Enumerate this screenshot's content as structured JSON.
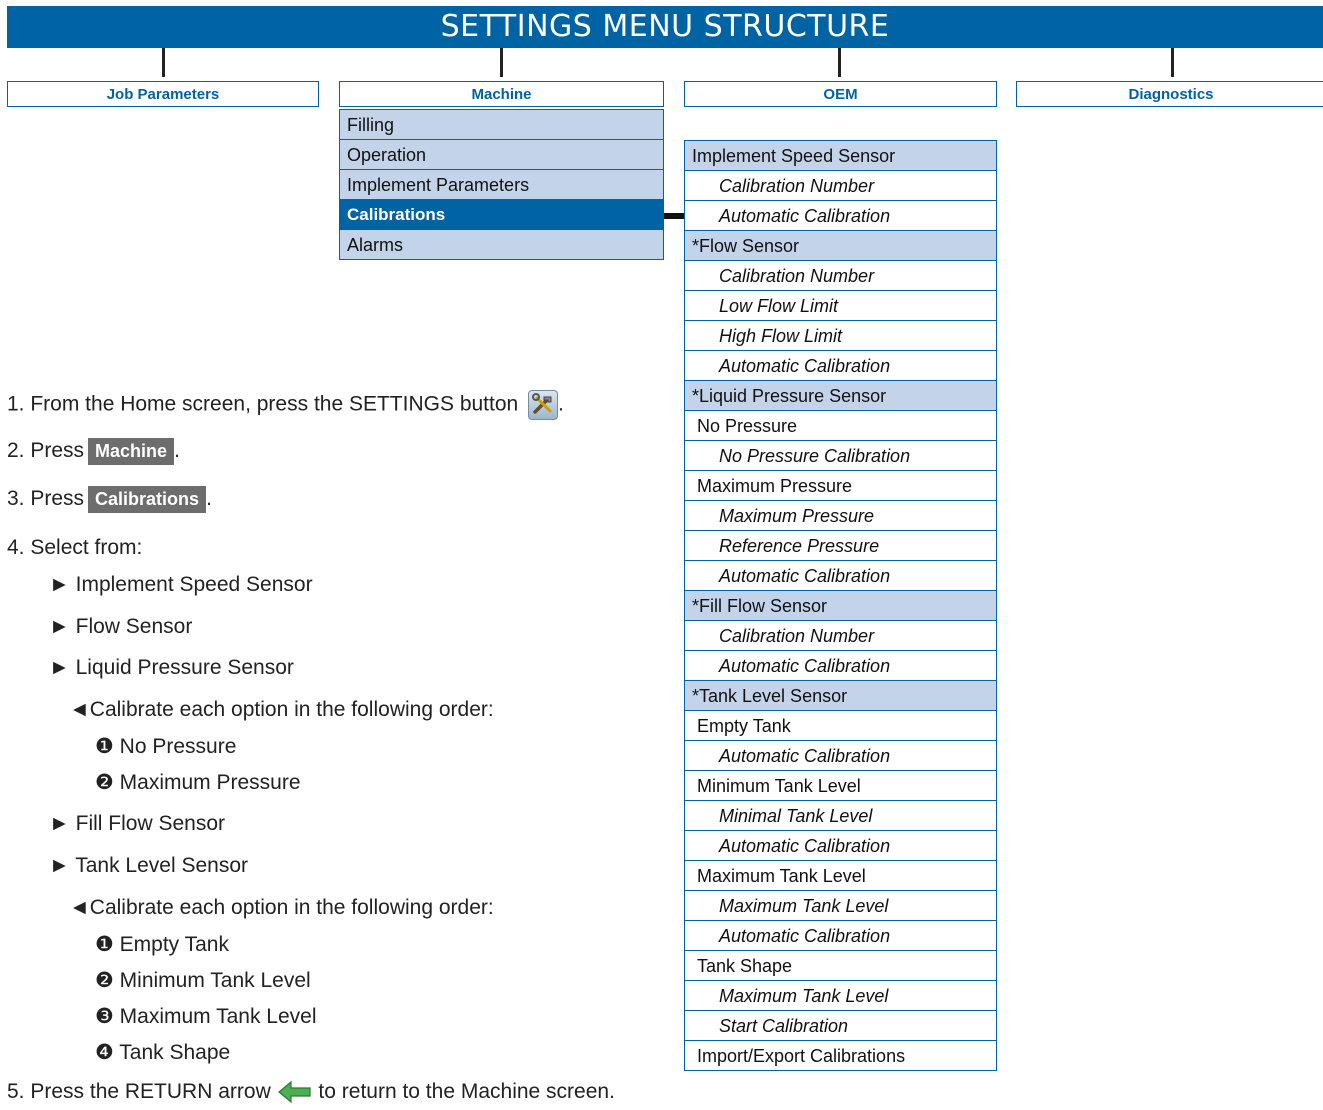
{
  "banner": {
    "title": "SETTINGS MENU STRUCTURE"
  },
  "tabs": [
    {
      "label": "Job Parameters"
    },
    {
      "label": "Machine"
    },
    {
      "label": "OEM"
    },
    {
      "label": "Diagnostics"
    }
  ],
  "machine_menu": [
    {
      "label": "Filling"
    },
    {
      "label": "Operation"
    },
    {
      "label": "Implement Parameters"
    },
    {
      "label": "Calibrations",
      "active": true
    },
    {
      "label": "Alarms"
    }
  ],
  "calibrations_menu": [
    {
      "label": "Implement Speed Sensor",
      "kind": "hdr"
    },
    {
      "label": "Calibration Number",
      "kind": "item"
    },
    {
      "label": "Automatic Calibration",
      "kind": "item"
    },
    {
      "label": "*Flow Sensor",
      "kind": "hdr"
    },
    {
      "label": "Calibration Number",
      "kind": "item"
    },
    {
      "label": "Low Flow Limit",
      "kind": "item"
    },
    {
      "label": "High Flow Limit",
      "kind": "item"
    },
    {
      "label": "Automatic Calibration",
      "kind": "item"
    },
    {
      "label": "*Liquid Pressure Sensor",
      "kind": "hdr"
    },
    {
      "label": "No Pressure",
      "kind": "sub"
    },
    {
      "label": "No Pressure Calibration",
      "kind": "item"
    },
    {
      "label": "Maximum Pressure",
      "kind": "sub"
    },
    {
      "label": "Maximum Pressure",
      "kind": "item"
    },
    {
      "label": "Reference Pressure",
      "kind": "item"
    },
    {
      "label": "Automatic Calibration",
      "kind": "item"
    },
    {
      "label": "*Fill Flow Sensor",
      "kind": "hdr"
    },
    {
      "label": "Calibration Number",
      "kind": "item"
    },
    {
      "label": "Automatic Calibration",
      "kind": "item"
    },
    {
      "label": "*Tank Level Sensor",
      "kind": "hdr"
    },
    {
      "label": "Empty Tank",
      "kind": "sub"
    },
    {
      "label": "Automatic Calibration",
      "kind": "item"
    },
    {
      "label": "Minimum Tank Level",
      "kind": "sub"
    },
    {
      "label": "Minimal Tank Level",
      "kind": "item"
    },
    {
      "label": "Automatic Calibration",
      "kind": "item"
    },
    {
      "label": "Maximum Tank Level",
      "kind": "sub"
    },
    {
      "label": "Maximum Tank Level",
      "kind": "item"
    },
    {
      "label": "Automatic Calibration",
      "kind": "item"
    },
    {
      "label": "Tank Shape",
      "kind": "sub"
    },
    {
      "label": "Maximum Tank Level",
      "kind": "item"
    },
    {
      "label": "Start Calibration",
      "kind": "item"
    },
    {
      "label": "Import/Export Calibrations",
      "kind": "sub"
    }
  ],
  "steps": {
    "s1_pre": "1. From the Home screen, press the SETTINGS button",
    "s1_post": ".",
    "s2_pre": "2. Press",
    "s2_btn": "Machine",
    "s2_post": ".",
    "s3_pre": "3. Press",
    "s3_btn": "Calibrations",
    "s3_post": ".",
    "s4": "4. Select from:",
    "b1": "► Implement Speed Sensor",
    "b2": "► Flow Sensor",
    "b3": "► Liquid Pressure Sensor",
    "b3_note": "◄Calibrate each option in the following order:",
    "b3_n1": "❶ No Pressure",
    "b3_n2": "❷ Maximum Pressure",
    "b4": "► Fill Flow Sensor",
    "b5": "► Tank Level Sensor",
    "b5_note": "◄Calibrate each option in the following order:",
    "b5_n1": "❶ Empty Tank",
    "b5_n2": "❷ Minimum Tank Level",
    "b5_n3": "❸ Maximum Tank Level",
    "b5_n4": "❹ Tank Shape",
    "s5_pre": "5. Press the RETURN arrow",
    "s5_post": "to return to the Machine screen."
  },
  "icons": {
    "settings": "settings-tools-icon",
    "return": "return-arrow-icon"
  }
}
